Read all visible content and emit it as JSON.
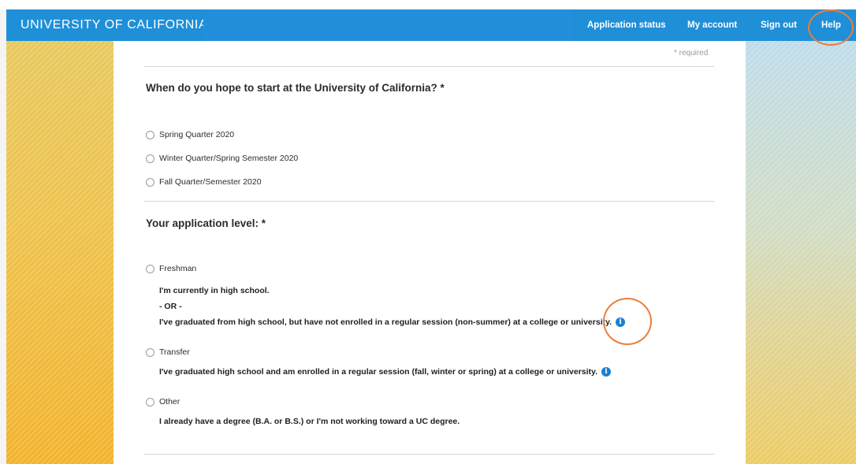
{
  "header": {
    "brand": "UNIVERSITY OF CALIFORNIA",
    "nav": {
      "application_status": "Application status",
      "my_account": "My account",
      "sign_out": "Sign out",
      "help": "Help"
    }
  },
  "form": {
    "required_note": "* required",
    "start_question": "When do you hope to start at the University of California? *",
    "start_options": [
      "Spring Quarter 2020",
      "Winter Quarter/Spring Semester 2020",
      "Fall Quarter/Semester 2020"
    ],
    "level_question": "Your application level: *",
    "level_options": [
      {
        "label": "Freshman",
        "lines": [
          "I'm currently in high school.",
          "- OR -",
          "I've graduated from high school, but have not enrolled in a regular session (non-summer) at a college or university."
        ]
      },
      {
        "label": "Transfer",
        "lines": [
          "I've graduated high school and am enrolled in a regular session (fall, winter or spring) at a college or university."
        ]
      },
      {
        "label": "Other",
        "lines": [
          "I already have a degree (B.A. or B.S.) or I'm not working toward a UC degree."
        ]
      }
    ]
  },
  "icons": {
    "info": "info-icon",
    "radio": "radio-button"
  },
  "colors": {
    "header_blue": "#1f8fd8",
    "highlight_ring": "#ec7e3c",
    "info_blue": "#1a7fd0"
  }
}
